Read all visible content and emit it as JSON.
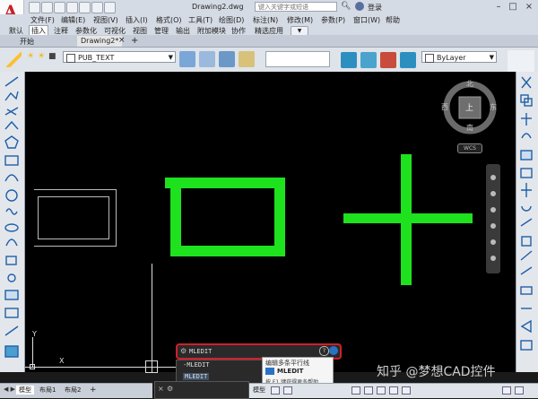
{
  "app": {
    "logo": "A",
    "file_title": "Drawing2.dwg",
    "search_placeholder": "键入关键字或短语",
    "login": "登录"
  },
  "menu": [
    "文件(F)",
    "编辑(E)",
    "视图(V)",
    "插入(I)",
    "格式(O)",
    "工具(T)",
    "绘图(D)",
    "标注(N)",
    "修改(M)",
    "参数(P)",
    "窗口(W)",
    "帮助"
  ],
  "ribbon_tabs": [
    "默认",
    "插入",
    "注释",
    "参数化",
    "可视化",
    "视图",
    "管理",
    "输出",
    "附加模块",
    "协作",
    "精选应用"
  ],
  "ribbon_active": "插入",
  "doc_tabs": {
    "start": "开始",
    "drawing": "Drawing2*"
  },
  "toolbar": {
    "layer_name": "PUB_TEXT",
    "color": "ByLayer"
  },
  "viewcube": {
    "north": "北",
    "south": "南",
    "east": "东",
    "west": "西",
    "top": "上",
    "wcs": "WCS"
  },
  "ucs": {
    "y": "Y",
    "x": "X"
  },
  "command": {
    "input": "MLEDIT",
    "suggestions": [
      "-MLEDIT",
      "MLEDIT"
    ],
    "tooltip_title": "编辑多条平行线",
    "tooltip_cmd": "MLEDIT",
    "tooltip_hint": "按 F1 键获得更多帮助"
  },
  "layout_tabs": [
    "布局1",
    "布局2"
  ],
  "status": {
    "model": "模型"
  },
  "watermark": "知乎 @梦想CAD控件",
  "colors": {
    "green": "#1ee21e",
    "red_highlight": "#d0202a",
    "canvas": "#000000"
  }
}
